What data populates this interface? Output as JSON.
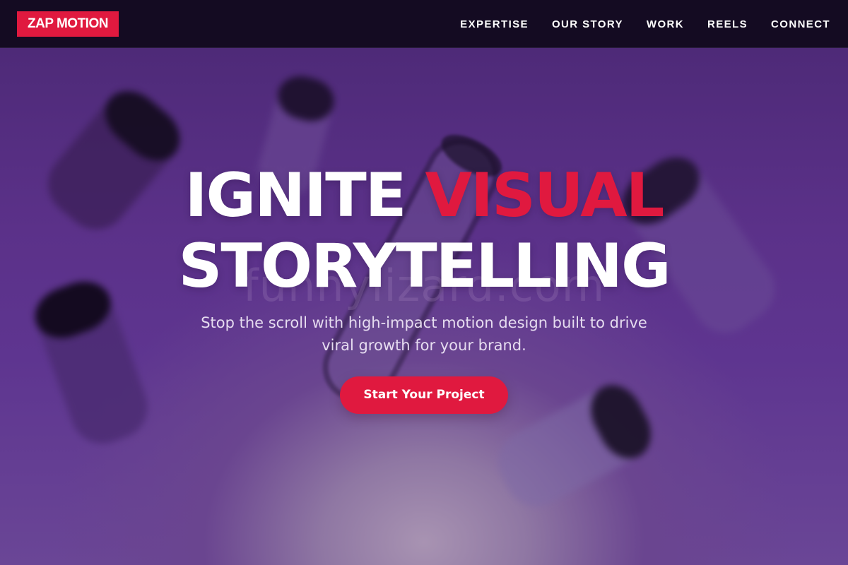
{
  "header": {
    "logo": "ZAP MOTION",
    "nav": [
      "EXPERTISE",
      "OUR STORY",
      "WORK",
      "REELS",
      "CONNECT"
    ]
  },
  "hero": {
    "headline_white_1": "IGNITE ",
    "headline_accent": "VISUAL",
    "headline_white_2": "STORYTELLING",
    "watermark": "funnylizard.com",
    "subtitle": "Stop the scroll with high-impact motion design built to drive viral growth for your brand.",
    "cta": "Start Your Project"
  },
  "colors": {
    "accent": "#e0193f",
    "nav_bg": "#140b22",
    "hero_purple": "#5b3189"
  }
}
